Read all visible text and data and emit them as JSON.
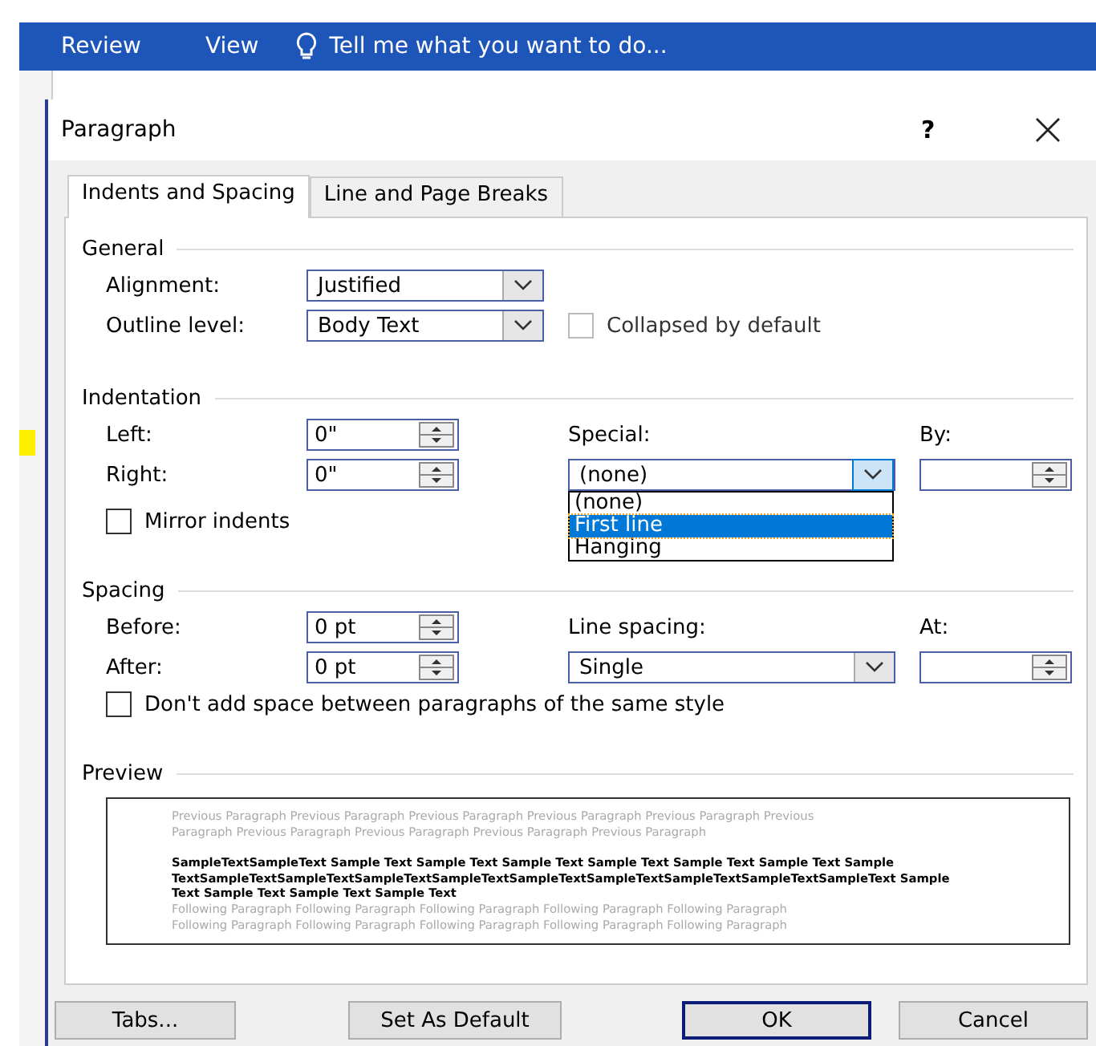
{
  "ribbon": {
    "tabs": [
      {
        "label": "Review",
        "selected": false
      },
      {
        "label": "View",
        "selected": false
      }
    ],
    "tell_me": "Tell me what you want to do..."
  },
  "dialog": {
    "title": "Paragraph",
    "help": "?",
    "tabs": [
      {
        "label": "Indents and Spacing",
        "selected": true
      },
      {
        "label": "Line and Page Breaks",
        "selected": false
      }
    ],
    "general": {
      "heading": "General",
      "alignment_label": "Alignment:",
      "alignment": "Justified",
      "outline_label": "Outline level:",
      "outline": "Body Text",
      "collapsed": {
        "label": "Collapsed by default",
        "checked": false,
        "disabled": true
      }
    },
    "indentation": {
      "heading": "Indentation",
      "left_label": "Left:",
      "left": "0\"",
      "right_label": "Right:",
      "right": "0\"",
      "special_label": "Special:",
      "special": "(none)",
      "by_label": "By:",
      "special_options": [
        {
          "label": "(none)",
          "selected": false
        },
        {
          "label": "First line",
          "selected": true
        },
        {
          "label": "Hanging",
          "selected": false
        }
      ],
      "mirror": {
        "label": "Mirror indents",
        "checked": false
      }
    },
    "spacing": {
      "heading": "Spacing",
      "before_label": "Before:",
      "before": "0 pt",
      "after_label": "After:",
      "after": "0 pt",
      "line_label": "Line spacing:",
      "line": "Single",
      "at_label": "At:",
      "dont_add": {
        "label": "Don't add space between paragraphs of the same style",
        "checked": false
      }
    },
    "preview": {
      "heading": "Preview",
      "previous": [
        "Previous Paragraph Previous Paragraph Previous Paragraph Previous Paragraph Previous Paragraph Previous",
        "Paragraph Previous Paragraph Previous Paragraph Previous Paragraph Previous Paragraph"
      ],
      "sample": [
        "SampleTextSampleText Sample Text Sample Text Sample Text Sample Text Sample Text Sample Text Sample",
        "TextSampleTextSampleTextSampleTextSampleTextSampleTextSampleTextSampleTextSampleTextSampleText Sample",
        "Text Sample Text Sample Text Sample Text"
      ],
      "following": [
        "Following Paragraph Following Paragraph Following Paragraph Following Paragraph Following Paragraph",
        "Following Paragraph Following Paragraph Following Paragraph Following Paragraph Following Paragraph"
      ]
    },
    "buttons": [
      {
        "label": "Tabs...",
        "default": false
      },
      {
        "label": "Set As Default",
        "default": false
      },
      {
        "label": "OK",
        "default": true
      },
      {
        "label": "Cancel",
        "default": false
      }
    ]
  }
}
